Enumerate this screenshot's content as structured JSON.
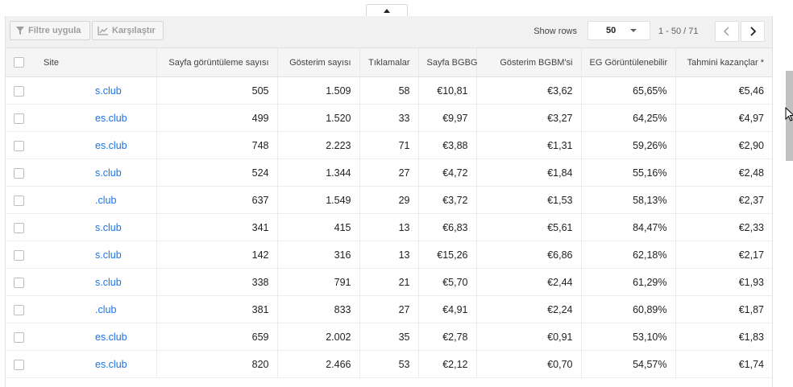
{
  "toolbar": {
    "filter_label": "Filtre uygula",
    "compare_label": "Karşılaştır",
    "show_rows_label": "Show rows",
    "rows_value": "50",
    "range_text": "1 - 50 / 71"
  },
  "table": {
    "columns": [
      "Site",
      "Sayfa görüntüleme sayısı",
      "Gösterim sayısı",
      "Tıklamalar",
      "Sayfa BGBG",
      "Gösterim BGBM'si",
      "EG Görüntülenebilir",
      "Tahmini kazançlar *"
    ],
    "rows": [
      [
        "s.club",
        "505",
        "1.509",
        "58",
        "€10,81",
        "€3,62",
        "65,65%",
        "€5,46"
      ],
      [
        "es.club",
        "499",
        "1.520",
        "33",
        "€9,97",
        "€3,27",
        "64,25%",
        "€4,97"
      ],
      [
        "es.club",
        "748",
        "2.223",
        "71",
        "€3,88",
        "€1,31",
        "59,26%",
        "€2,90"
      ],
      [
        "s.club",
        "524",
        "1.344",
        "27",
        "€4,72",
        "€1,84",
        "55,16%",
        "€2,48"
      ],
      [
        ".club",
        "637",
        "1.549",
        "29",
        "€3,72",
        "€1,53",
        "58,13%",
        "€2,37"
      ],
      [
        "s.club",
        "341",
        "415",
        "13",
        "€6,83",
        "€5,61",
        "84,47%",
        "€2,33"
      ],
      [
        "s.club",
        "142",
        "316",
        "13",
        "€15,26",
        "€6,86",
        "62,18%",
        "€2,17"
      ],
      [
        "s.club",
        "338",
        "791",
        "21",
        "€5,70",
        "€2,44",
        "61,29%",
        "€1,93"
      ],
      [
        ".club",
        "381",
        "833",
        "27",
        "€4,91",
        "€2,24",
        "60,89%",
        "€1,87"
      ],
      [
        "es.club",
        "659",
        "2.002",
        "35",
        "€2,78",
        "€0,91",
        "53,10%",
        "€1,83"
      ],
      [
        "es.club",
        "820",
        "2.466",
        "53",
        "€2,12",
        "€0,70",
        "54,57%",
        "€1,74"
      ]
    ]
  },
  "icons": {
    "collapse": "caret-up-icon",
    "filter": "filter-icon",
    "compare": "line-chart-icon",
    "prev": "chevron-left-icon",
    "next": "chevron-right-icon",
    "cursor": "mouse-pointer-icon"
  },
  "colors": {
    "link": "#1a73e8",
    "toolbar_bg": "#f1f1f1",
    "header_bg": "#f5f5f5"
  }
}
